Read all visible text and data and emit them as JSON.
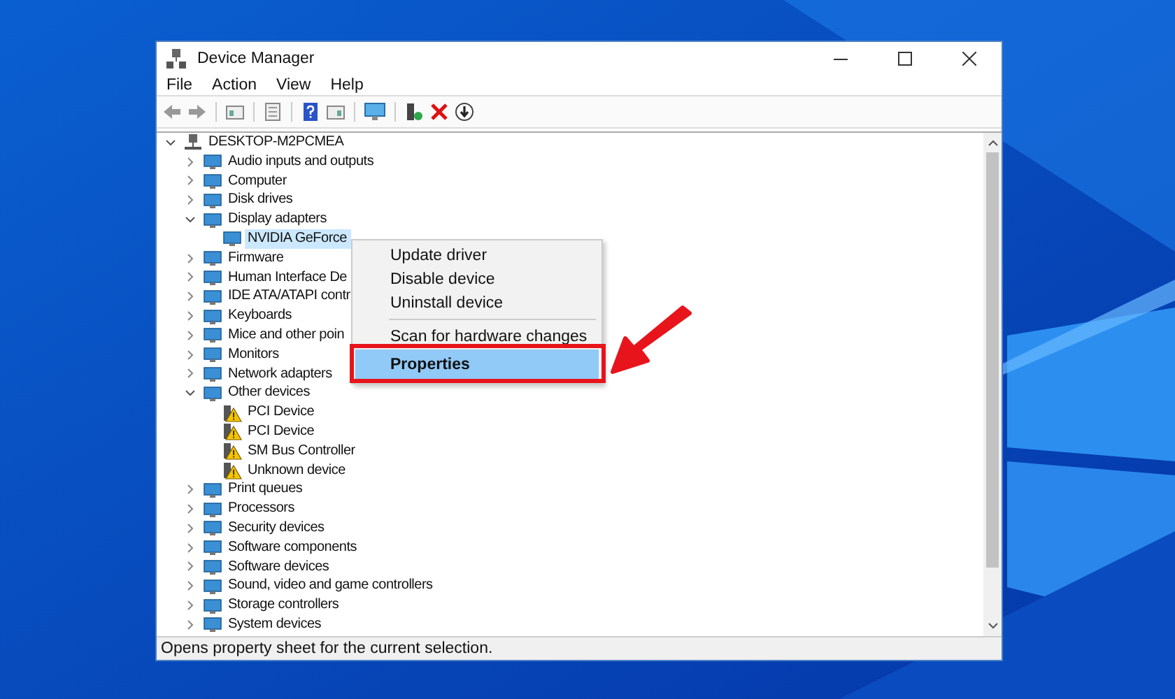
{
  "window": {
    "title": "Device Manager"
  },
  "menu": [
    "File",
    "Action",
    "View",
    "Help"
  ],
  "tree": {
    "label": "DESKTOP-M2PCMEA",
    "expanded": true,
    "selected": false,
    "children": [
      {
        "label": "Audio inputs and outputs",
        "expanded": false,
        "selected": false
      },
      {
        "label": "Computer",
        "expanded": false,
        "selected": false
      },
      {
        "label": "Disk drives",
        "expanded": false,
        "selected": false
      },
      {
        "label": "Display adapters",
        "expanded": true,
        "selected": false,
        "children": [
          {
            "label": "NVIDIA GeForce",
            "selected": true,
            "warning": false
          }
        ]
      },
      {
        "label": "Firmware",
        "expanded": false,
        "selected": false
      },
      {
        "label": "Human Interface De",
        "expanded": false,
        "selected": false
      },
      {
        "label": "IDE ATA/ATAPI contr",
        "expanded": false,
        "selected": false
      },
      {
        "label": "Keyboards",
        "expanded": false,
        "selected": false
      },
      {
        "label": "Mice and other poin",
        "expanded": false,
        "selected": false
      },
      {
        "label": "Monitors",
        "expanded": false,
        "selected": false
      },
      {
        "label": "Network adapters",
        "expanded": false,
        "selected": false
      },
      {
        "label": "Other devices",
        "expanded": true,
        "selected": false,
        "children": [
          {
            "label": "PCI Device",
            "selected": false,
            "warning": true
          },
          {
            "label": "PCI Device",
            "selected": false,
            "warning": true
          },
          {
            "label": "SM Bus Controller",
            "selected": false,
            "warning": true
          },
          {
            "label": "Unknown device",
            "selected": false,
            "warning": true
          }
        ]
      },
      {
        "label": "Print queues",
        "expanded": false,
        "selected": false
      },
      {
        "label": "Processors",
        "expanded": false,
        "selected": false
      },
      {
        "label": "Security devices",
        "expanded": false,
        "selected": false
      },
      {
        "label": "Software components",
        "expanded": false,
        "selected": false
      },
      {
        "label": "Software devices",
        "expanded": false,
        "selected": false
      },
      {
        "label": "Sound, video and game controllers",
        "expanded": false,
        "selected": false
      },
      {
        "label": "Storage controllers",
        "expanded": false,
        "selected": false
      },
      {
        "label": "System devices",
        "expanded": false,
        "selected": false
      }
    ]
  },
  "context_menu": [
    {
      "label": "Update driver",
      "selected": false,
      "separator_before": false,
      "default": false
    },
    {
      "label": "Disable device",
      "selected": false,
      "separator_before": false,
      "default": false
    },
    {
      "label": "Uninstall device",
      "selected": false,
      "separator_before": false,
      "default": false
    },
    {
      "label": "Scan for hardware changes",
      "selected": false,
      "separator_before": true,
      "default": false
    },
    {
      "label": "Properties",
      "selected": true,
      "separator_before": false,
      "default": true
    }
  ],
  "status_bar": "Opens property sheet for the current selection."
}
